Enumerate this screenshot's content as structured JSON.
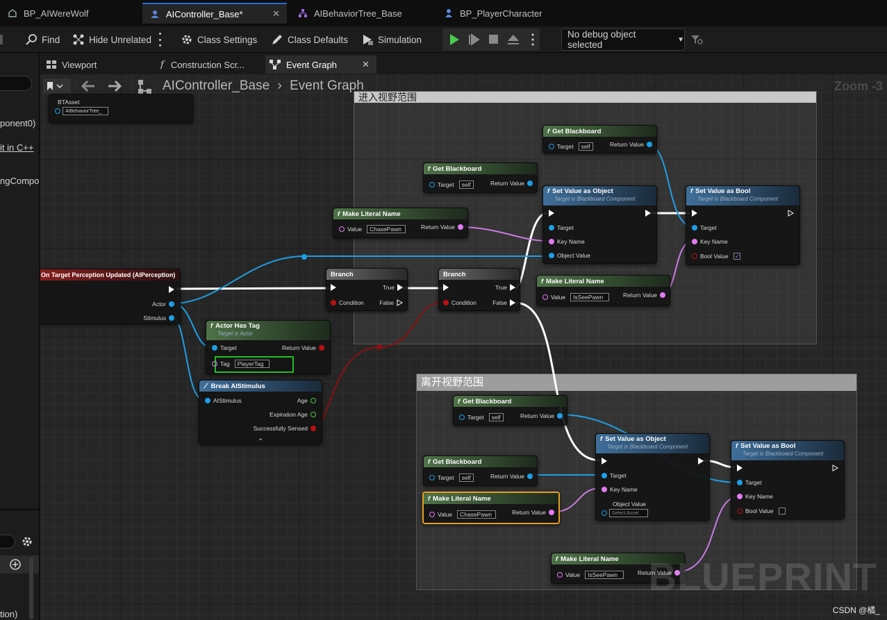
{
  "doc_tabs": [
    {
      "label": "BP_AIWereWolf"
    },
    {
      "label": "AIController_Base*"
    },
    {
      "label": "AIBehaviorTree_Base"
    },
    {
      "label": "BP_PlayerCharacter"
    }
  ],
  "toolbar": {
    "find": "Find",
    "hide_unrelated": "Hide Unrelated",
    "class_settings": "Class Settings",
    "class_defaults": "Class Defaults",
    "simulation": "Simulation",
    "debug_object": "No debug object selected"
  },
  "graph_tabs": [
    {
      "label": "Viewport"
    },
    {
      "label": "Construction Scr..."
    },
    {
      "label": "Event Graph"
    }
  ],
  "left_panel": {
    "line1": "ponent0)",
    "line2": "it in C++",
    "line3": "ngCompo",
    "line4": "tion)"
  },
  "graph": {
    "breadcrumb_root": "AIController_Base",
    "breadcrumb_sep": "›",
    "breadcrumb_leaf": "Event Graph",
    "zoom": "Zoom -3",
    "watermark": "BLUEPRINT",
    "credit": "CSDN @橘_"
  },
  "comments": {
    "enter": "进入视野范围",
    "leave": "离开视野范围"
  },
  "nodes": {
    "bt_asset_label": "BTAsset",
    "bt_asset_value": "AIBehaviorTree_",
    "event_title": "On Target Perception Updated (AIPerception)",
    "event_actor": "Actor",
    "event_stimulus": "Stimulus",
    "branch": "Branch",
    "true": "True",
    "false": "False",
    "condition": "Condition",
    "actor_has_tag": "Actor Has Tag",
    "target_is_actor": "Target is Actor",
    "target": "Target",
    "return_value": "Return Value",
    "tag": "Tag",
    "tag_value": "PlayerTag",
    "break_stimulus": "Break AIStimulus",
    "ai_stimulus": "AIStimulus",
    "age": "Age",
    "expiration_age": "Expiration Age",
    "successfully_sensed": "Successfully Sensed",
    "get_blackboard": "Get Blackboard",
    "self": "self",
    "set_value_object": "Set Value as Object",
    "set_value_bool": "Set Value as Bool",
    "target_is_bb": "Target is Blackboard Component",
    "key_name": "Key Name",
    "object_value": "Object Value",
    "bool_value": "Bool Value",
    "select_asset": "Select Asset",
    "make_literal_name": "Make Literal Name",
    "value": "Value",
    "chase_pawn": "ChasePawn",
    "is_see_pawn": "IsSeePawn"
  }
}
